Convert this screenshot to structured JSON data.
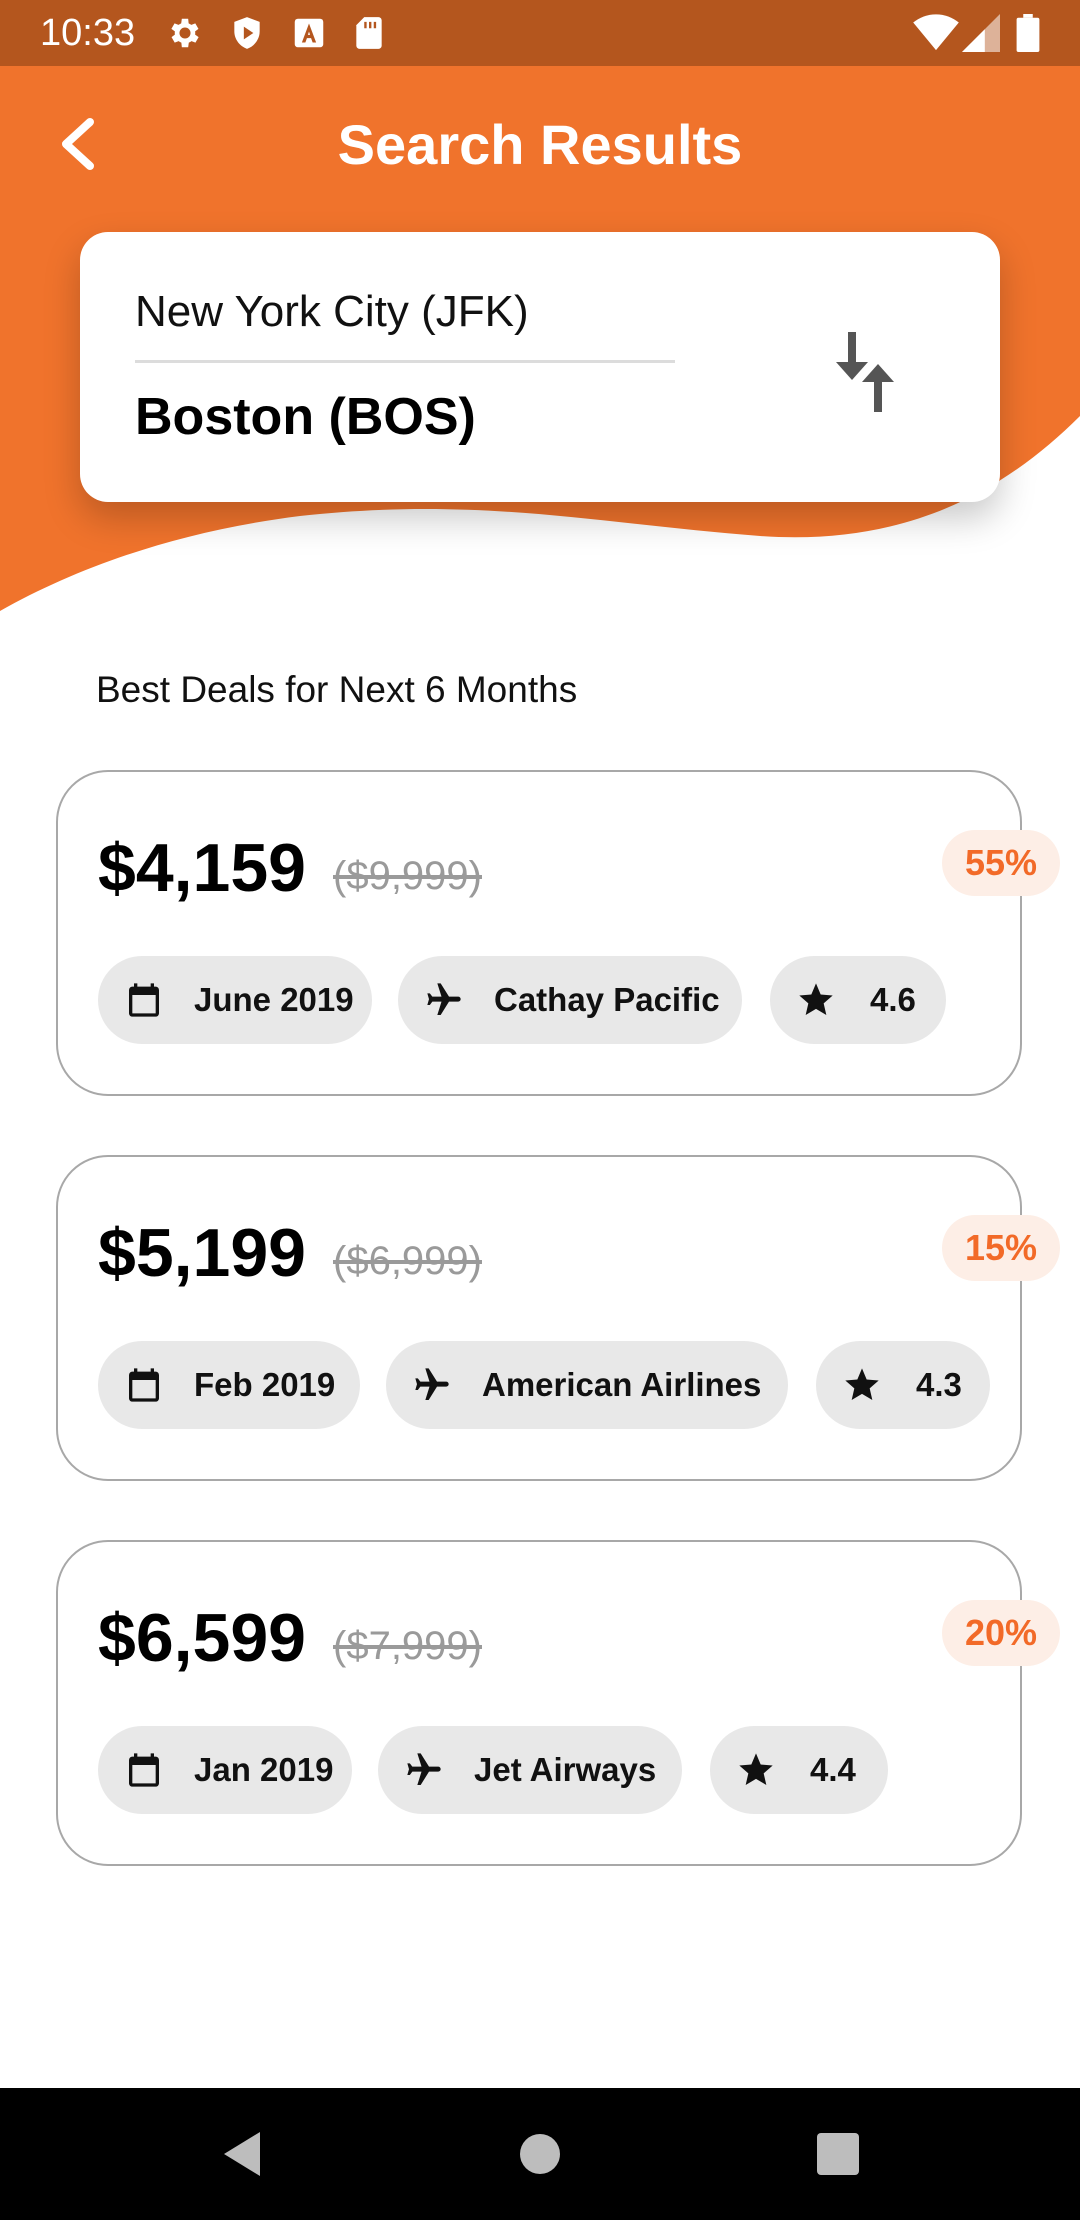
{
  "status_bar": {
    "time": "10:33",
    "icons": [
      "settings-icon",
      "shield-play-icon",
      "font-a-icon",
      "sd-card-icon",
      "wifi-icon",
      "signal-icon",
      "battery-icon"
    ]
  },
  "header": {
    "title": "Search Results",
    "back_icon": "chevron-left-icon",
    "background_color": "#f0732c"
  },
  "route": {
    "from": "New York City (JFK)",
    "to": "Boston (BOS)",
    "swap_icon": "swap-vertical-icon"
  },
  "section_title": "Best Deals for Next 6 Months",
  "deals": [
    {
      "price": "$4,159",
      "original_price": "($9,999)",
      "discount": "55%",
      "date": "June 2019",
      "airline": "Cathay Pacific",
      "rating": "4.6"
    },
    {
      "price": "$5,199",
      "original_price": "($6,999)",
      "discount": "15%",
      "date": "Feb 2019",
      "airline": "American Airlines",
      "rating": "4.3"
    },
    {
      "price": "$6,599",
      "original_price": "($7,999)",
      "discount": "20%",
      "date": "Jan 2019",
      "airline": "Jet Airways",
      "rating": "4.4"
    }
  ],
  "nav_bar": {
    "buttons": [
      "back-triangle-icon",
      "home-circle-icon",
      "recents-square-icon"
    ]
  },
  "colors": {
    "accent": "#f0732c",
    "status_bar": "#b4561e",
    "badge_text": "#f26a28",
    "badge_bg": "#fdeee6",
    "chip_bg": "#e8e8e8"
  }
}
